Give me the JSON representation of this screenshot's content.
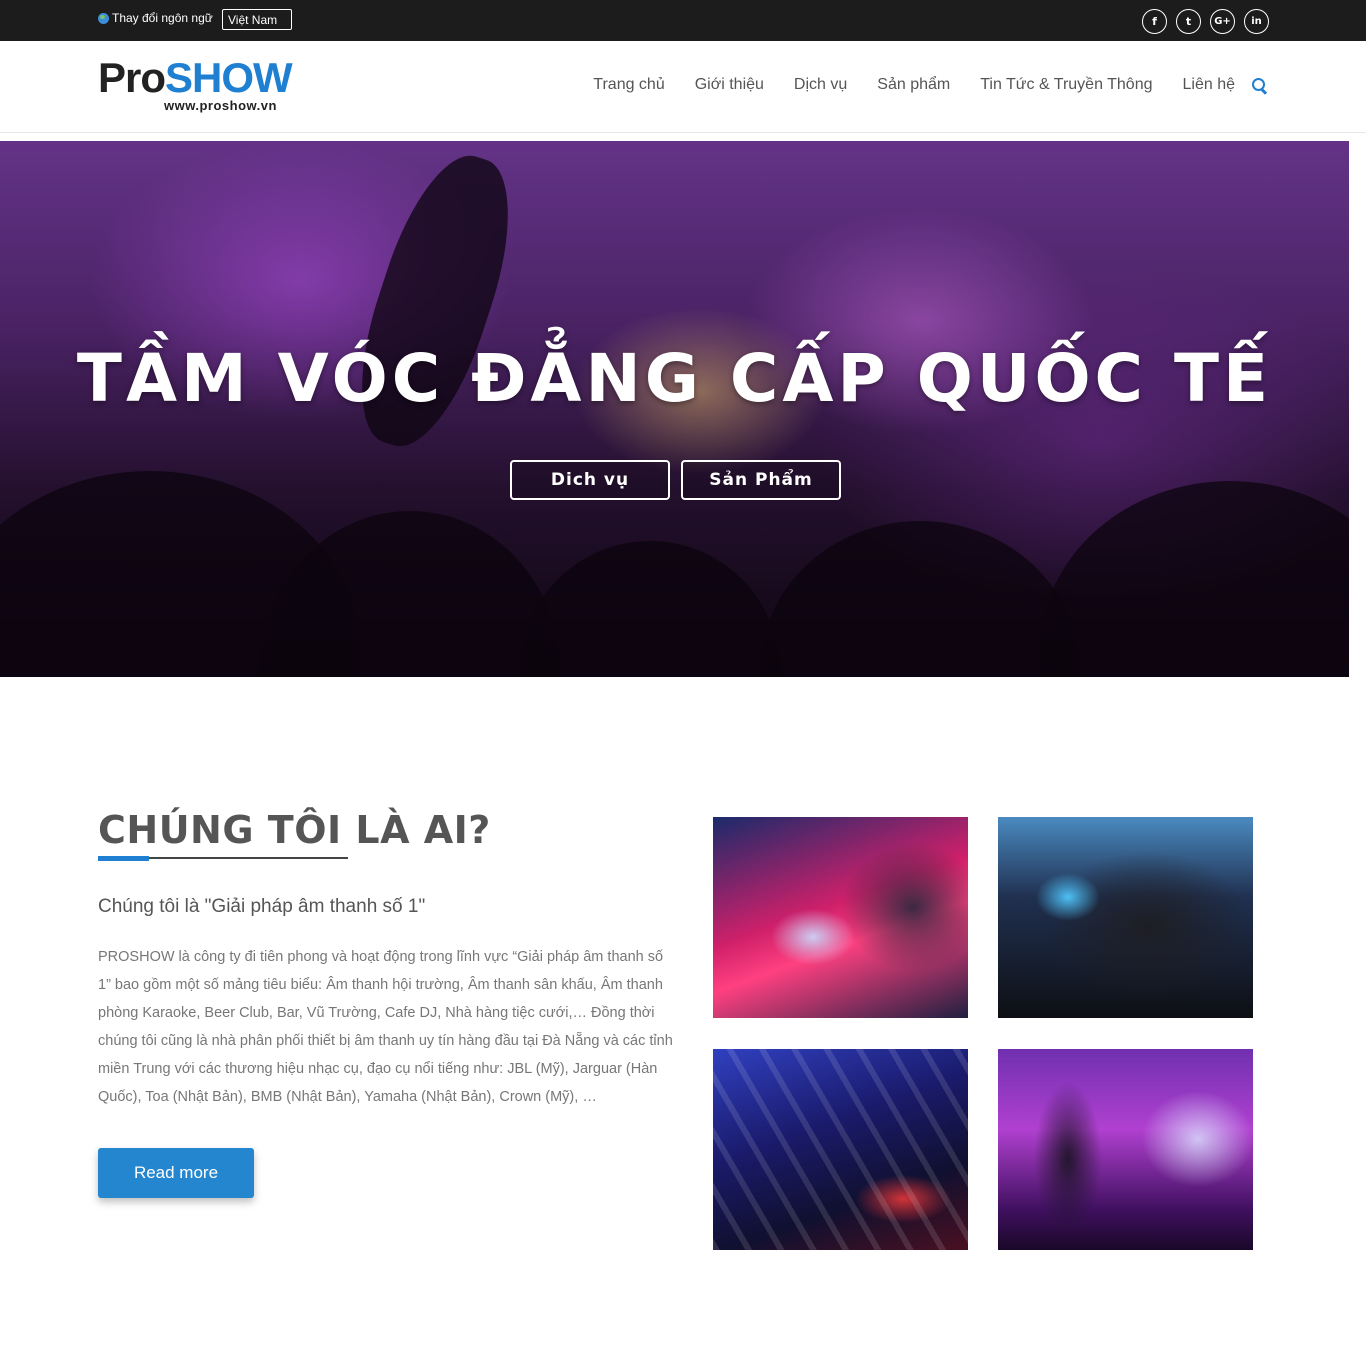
{
  "topbar": {
    "language_label": "Thay đổi ngôn ngữ",
    "language_selected": "Việt Nam",
    "socials": [
      {
        "icon": "facebook-icon",
        "glyph": "f"
      },
      {
        "icon": "twitter-icon",
        "glyph": "t"
      },
      {
        "icon": "google-plus-icon",
        "glyph": "G+"
      },
      {
        "icon": "linkedin-icon",
        "glyph": "in"
      }
    ]
  },
  "header": {
    "logo_pro": "Pro",
    "logo_show": "SHOW",
    "logo_url": "www.proshow.vn",
    "nav": [
      "Trang chủ",
      "Giới thiệu",
      "Dịch vụ",
      "Sản phẩm",
      "Tin Tức & Truyền Thông",
      "Liên hệ"
    ]
  },
  "hero": {
    "title": "TẦM VÓC ĐẲNG CẤP QUỐC TẾ",
    "buttons": [
      "Dich vụ",
      "Sản Phẩm"
    ]
  },
  "about": {
    "title": "CHÚNG TÔI LÀ AI?",
    "subtitle": "Chúng tôi là \"Giải pháp âm thanh số 1\"",
    "body": "PROSHOW là công ty đi tiên phong và hoạt động trong lĩnh vực “Giải pháp âm thanh số 1”  bao gồm một số mảng tiêu biểu: Âm thanh hội trường, Âm thanh sân khấu, Âm thanh phòng Karaoke, Beer Club, Bar, Vũ Trường, Cafe DJ, Nhà hàng tiệc cưới,… Đồng thời chúng tôi cũng là nhà phân phối thiết bị âm thanh uy tín hàng đầu tại Đà Nẵng và các tỉnh miền Trung với các thương hiệu nhạc cụ, đạo cụ nổi tiếng như: JBL (Mỹ), Jarguar (Hàn Quốc), Toa (Nhật Bản), BMB (Nhật Bản), Yamaha (Nhật Bản), Crown (Mỹ), …",
    "read_more": "Read more"
  },
  "colors": {
    "accent": "#1f7fd1",
    "topbar": "#1c1c1c"
  }
}
